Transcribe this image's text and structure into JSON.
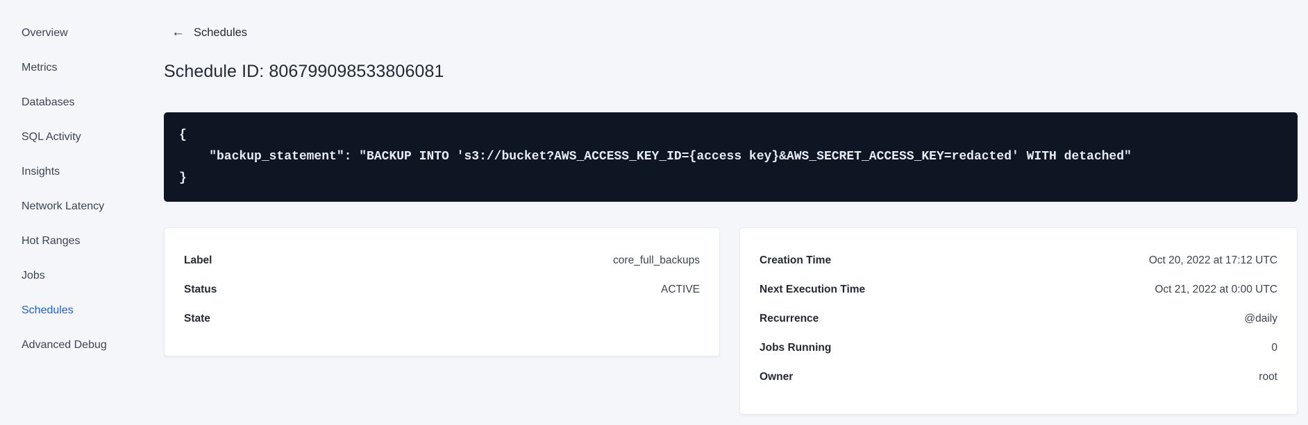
{
  "sidebar": {
    "items": [
      {
        "label": "Overview",
        "active": false
      },
      {
        "label": "Metrics",
        "active": false
      },
      {
        "label": "Databases",
        "active": false
      },
      {
        "label": "SQL Activity",
        "active": false
      },
      {
        "label": "Insights",
        "active": false
      },
      {
        "label": "Network Latency",
        "active": false
      },
      {
        "label": "Hot Ranges",
        "active": false
      },
      {
        "label": "Jobs",
        "active": false
      },
      {
        "label": "Schedules",
        "active": true
      },
      {
        "label": "Advanced Debug",
        "active": false
      }
    ]
  },
  "breadcrumb": {
    "back_icon": "←",
    "back_label": "Schedules"
  },
  "page": {
    "title": "Schedule ID: 806799098533806081"
  },
  "code_block": {
    "lines": [
      "{",
      "    \"backup_statement\": \"BACKUP INTO 's3://bucket?AWS_ACCESS_KEY_ID={access key}&AWS_SECRET_ACCESS_KEY=redacted' WITH detached\"",
      "}"
    ]
  },
  "details_card": {
    "rows": [
      {
        "label": "Label",
        "value": "core_full_backups"
      },
      {
        "label": "Status",
        "value": "ACTIVE"
      },
      {
        "label": "State",
        "value": ""
      }
    ]
  },
  "execution_card": {
    "rows": [
      {
        "label": "Creation Time",
        "value": "Oct 20, 2022 at 17:12 UTC"
      },
      {
        "label": "Next Execution Time",
        "value": "Oct 21, 2022 at 0:00 UTC"
      },
      {
        "label": "Recurrence",
        "value": "@daily"
      },
      {
        "label": "Jobs Running",
        "value": "0"
      },
      {
        "label": "Owner",
        "value": "root"
      }
    ]
  },
  "colors": {
    "active_link": "#1a5eff",
    "code_background": "#0e1624",
    "page_background": "#f4f6f9"
  }
}
